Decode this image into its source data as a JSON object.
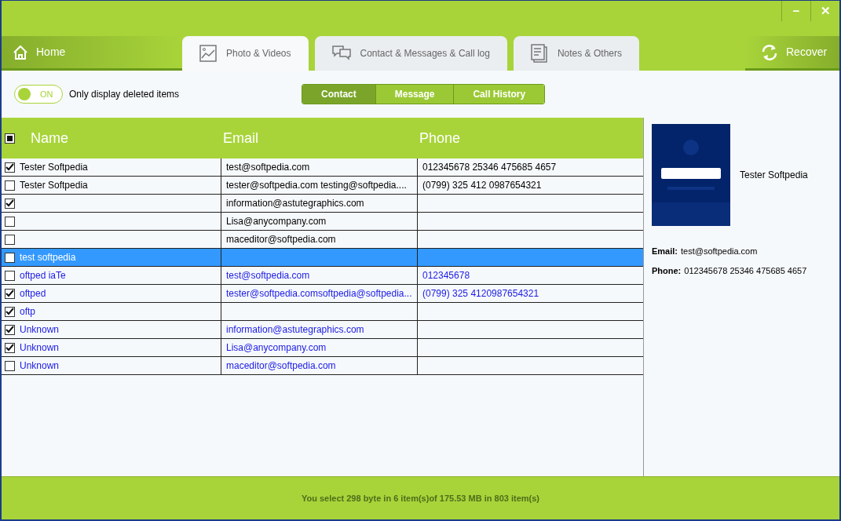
{
  "window_controls": {
    "minimize": "−",
    "close": "✕"
  },
  "home": {
    "label": "Home"
  },
  "tabs": [
    {
      "label": "Photo & Videos",
      "selected": true
    },
    {
      "label": "Contact & Messages & Call log",
      "selected": false
    },
    {
      "label": "Notes & Others",
      "selected": false
    }
  ],
  "recover": {
    "label": "Recover"
  },
  "toggle": {
    "label": "ON",
    "on": true,
    "caption": "Only display deleted items"
  },
  "segments": [
    {
      "label": "Contact",
      "selected": true
    },
    {
      "label": "Message",
      "selected": false
    },
    {
      "label": "Call History",
      "selected": false
    }
  ],
  "table": {
    "header_partial": true,
    "columns": [
      "Name",
      "Email",
      "Phone"
    ],
    "rows": [
      {
        "name": "Tester Softpedia",
        "email": "test@softpedia.com",
        "phone": "012345678 25346 475685 4657",
        "checked": true,
        "selected": false,
        "deleted": false
      },
      {
        "name": "Tester Softpedia",
        "email": "tester@softpedia.com testing@softpedia....",
        "phone": "(0799) 325 412 0987654321",
        "checked": false,
        "selected": false,
        "deleted": false
      },
      {
        "name": "",
        "email": "information@astutegraphics.com",
        "phone": "",
        "checked": true,
        "selected": false,
        "deleted": false
      },
      {
        "name": "",
        "email": "Lisa@anycompany.com",
        "phone": "",
        "checked": false,
        "selected": false,
        "deleted": false
      },
      {
        "name": "",
        "email": "maceditor@softpedia.com",
        "phone": "",
        "checked": false,
        "selected": false,
        "deleted": false
      },
      {
        "name": "test softpedia",
        "email": "",
        "phone": "",
        "checked": false,
        "selected": true,
        "deleted": false
      },
      {
        "name": "oftped iaTe",
        "email": "test@softpedia.com",
        "phone": "012345678",
        "checked": false,
        "selected": false,
        "deleted": true
      },
      {
        "name": "oftped",
        "email": "tester@softpedia.comsoftpedia@softpedia...",
        "phone": "(0799) 325 4120987654321",
        "checked": true,
        "selected": false,
        "deleted": true
      },
      {
        "name": "oftp",
        "email": "",
        "phone": "",
        "checked": true,
        "selected": false,
        "deleted": true
      },
      {
        "name": "Unknown",
        "email": "information@astutegraphics.com",
        "phone": "",
        "checked": true,
        "selected": false,
        "deleted": true
      },
      {
        "name": "Unknown",
        "email": "Lisa@anycompany.com",
        "phone": "",
        "checked": true,
        "selected": false,
        "deleted": true
      },
      {
        "name": "Unknown",
        "email": "maceditor@softpedia.com",
        "phone": "",
        "checked": false,
        "selected": false,
        "deleted": true
      }
    ]
  },
  "details": {
    "name": "Tester Softpedia",
    "fields": [
      {
        "label": "Email:",
        "value": "test@softpedia.com"
      },
      {
        "label": "Phone:",
        "value": "012345678 25346 475685 4657"
      }
    ]
  },
  "status_bar": "You select 298 byte in 6 item(s)of 175.53 MB in 803 item(s)"
}
